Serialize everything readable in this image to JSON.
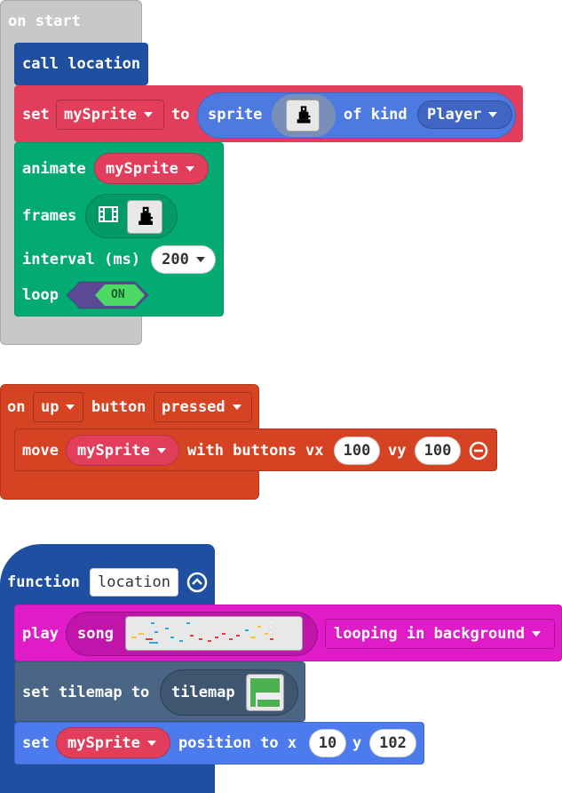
{
  "on_start": {
    "label": "on start",
    "call": {
      "label": "call",
      "name": "location"
    },
    "set_sprite": {
      "set_label": "set",
      "variable": "mySprite",
      "to_label": "to",
      "sprite_label": "sprite",
      "of_kind_label": "of kind",
      "kind": "Player"
    },
    "animate": {
      "animate_label": "animate",
      "variable": "mySprite",
      "frames_label": "frames",
      "interval_label": "interval (ms)",
      "interval_value": "200",
      "loop_label": "loop",
      "loop_toggle": "ON"
    }
  },
  "on_button": {
    "on_label": "on",
    "button_name": "up",
    "button_label": "button",
    "event": "pressed",
    "move": {
      "move_label": "move",
      "variable": "mySprite",
      "with_buttons_label": "with buttons vx",
      "vx": "100",
      "vy_label": "vy",
      "vy": "100"
    }
  },
  "function_block": {
    "function_label": "function",
    "name": "location",
    "play": {
      "play_label": "play",
      "song_label": "song",
      "mode": "looping in background"
    },
    "tilemap": {
      "set_label": "set tilemap to",
      "tilemap_label": "tilemap"
    },
    "position": {
      "set_label": "set",
      "variable": "mySprite",
      "position_label": "position to x",
      "x": "10",
      "y_label": "y",
      "y": "102"
    }
  },
  "colors": {
    "events_gray": "#c8c8c8",
    "functions_blue": "#1e4fa0",
    "sprites_red": "#e23e5c",
    "sprites_blue": "#4c7ae0",
    "animation_green": "#03aa74",
    "logic_purple": "#5b4995",
    "controller_orange": "#d54322",
    "music_magenta": "#e01cc9",
    "scene_slate": "#4b6584",
    "scene_blue": "#4b7bec"
  }
}
